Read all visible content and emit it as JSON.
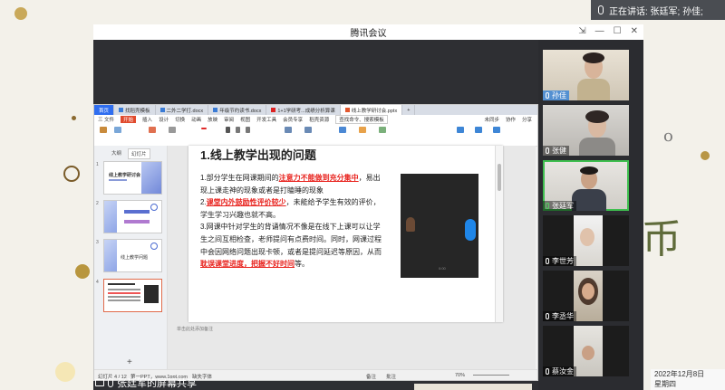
{
  "speaking_bar": {
    "text": "正在讲话: 张廷军; 孙佳;"
  },
  "window": {
    "title": "腾讯会议"
  },
  "wps": {
    "tabs": [
      {
        "label": "首页",
        "kind": "home"
      },
      {
        "label": "找稻壳模板",
        "kind": "doc"
      },
      {
        "label": "二外二学打.docx",
        "kind": "doc"
      },
      {
        "label": "年级节约读书.docx",
        "kind": "doc"
      },
      {
        "label": "1+1学研考...成绩分析算课",
        "kind": "pdf"
      },
      {
        "label": "线上教学研讨会.pptx",
        "kind": "ppt",
        "active": true
      }
    ],
    "menu": [
      "三 文件",
      "开始",
      "插入",
      "设计",
      "切换",
      "动画",
      "放映",
      "审阅",
      "视图",
      "开发工具",
      "会员专享",
      "稻壳资源",
      "查找命令、搜索模板"
    ],
    "menu_right": [
      "未同步",
      "协作",
      "分享"
    ],
    "pane_tabs": [
      "大纲",
      "幻灯片"
    ],
    "thumbs": [
      {
        "num": "1",
        "title": "线上教学研讨会"
      },
      {
        "num": "2",
        "title": ""
      },
      {
        "num": "3",
        "title": "线上教学问题"
      },
      {
        "num": "4",
        "title": ""
      }
    ],
    "slide": {
      "title": "1.线上教学出现的问题",
      "p1_a": "1.部分学生在网课期间的",
      "p1_red": "注意力不能做到充分集中",
      "p1_b": "，易出现上课走神的现象或者是打瞌睡的现象",
      "p2_num": "2.",
      "p2_red": "课堂内外鼓励性评价较少",
      "p2_b": "，未能给予学生有效的评价，学生学习兴趣也就不高。",
      "p3_a": "3.网课中针对学生的背诵情况不像是在线下上课可以让学生之间互相检查，老师提问有点费时间。同时，网课过程中会因网络问题出现卡顿，或者是提问延迟等原因，从而",
      "p3_red": "耽误课堂进度，把握不好时间",
      "p3_b": "等。",
      "video_time": "0:00"
    },
    "notes_placeholder": "单击此处添加备注",
    "status": {
      "left": "幻灯片 4 / 12",
      "theme": "第一PPT，www.1ppt.com",
      "font_missing": "缺失字体",
      "notes": "备注",
      "comments": "批注",
      "zoom": "70%"
    }
  },
  "share_label": "张廷军的屏幕共享",
  "participants": [
    {
      "name": "孙佳",
      "speaking": false
    },
    {
      "name": "张健",
      "speaking": false
    },
    {
      "name": "张廷军",
      "speaking": true
    },
    {
      "name": "李世芳",
      "speaking": false
    },
    {
      "name": "李丞华",
      "speaking": false
    },
    {
      "name": "蔡汝金",
      "speaking": false
    }
  ],
  "clock": {
    "date": "2022年12月8日",
    "weekday": "星期四"
  },
  "background_char": "币"
}
